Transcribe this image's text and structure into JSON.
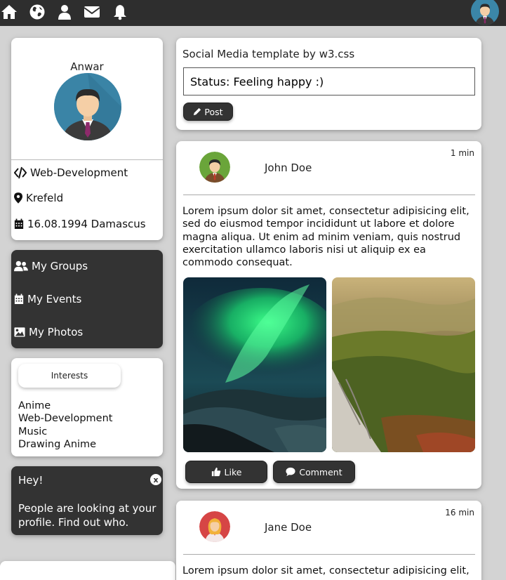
{
  "topbar": {
    "icons": [
      "home-icon",
      "globe-icon",
      "user-icon",
      "envelope-icon",
      "bell-icon"
    ]
  },
  "profile": {
    "name": "Anwar",
    "job": "Web-Development",
    "location": "Krefeld",
    "birth": "16.08.1994 Damascus"
  },
  "menu": {
    "groups": "My Groups",
    "events": "My Events",
    "photos": "My Photos"
  },
  "interests": {
    "button": "Interests",
    "items": [
      "Anime",
      "Web-Development",
      "Music",
      "Drawing Anime"
    ]
  },
  "alert": {
    "title": "Hey!",
    "body": "People are looking at your profile. Find out who.",
    "close": "x"
  },
  "status": {
    "title": "Social Media template by w3.css",
    "value": "Status: Feeling happy :)",
    "post_label": "Post"
  },
  "posts": [
    {
      "author": "John Doe",
      "time": "1 min",
      "text": "Lorem ipsum dolor sit amet, consectetur adipisicing elit, sed do eiusmod tempor incididunt ut labore et dolore magna aliqua. Ut enim ad minim veniam, quis nostrud exercitation ullamco laboris nisi ut aliquip ex ea commodo consequat.",
      "like_label": "Like",
      "comment_label": "Comment"
    },
    {
      "author": "Jane Doe",
      "time": "16 min",
      "text": "Lorem ipsum dolor sit amet, consectetur adipisicing elit,"
    }
  ],
  "colors": {
    "topbar": "#2e2e2e",
    "dark_card": "#333333",
    "background": "#d3d3d3"
  }
}
